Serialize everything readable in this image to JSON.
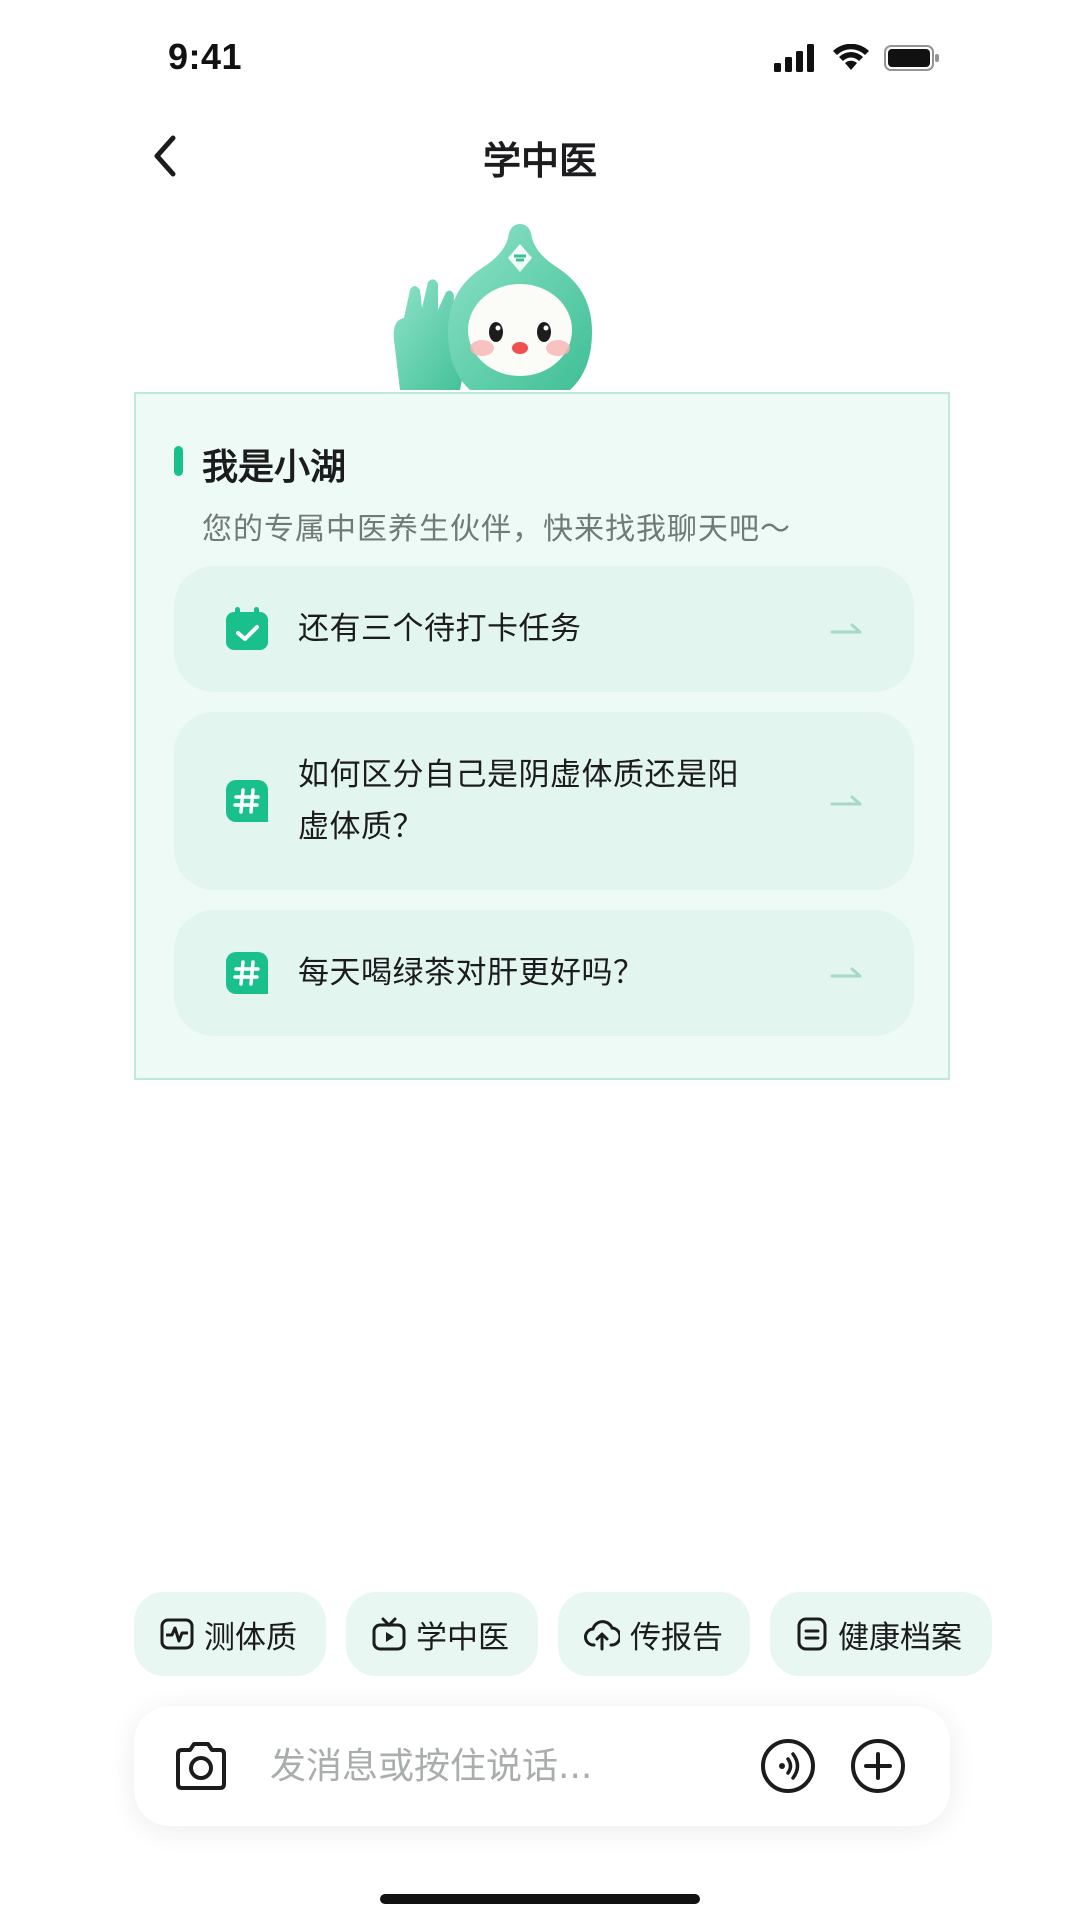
{
  "status_bar": {
    "time": "9:41"
  },
  "header": {
    "title": "学中医"
  },
  "card": {
    "title": "我是小湖",
    "subtitle": "您的专属中医养生伙伴，快来找我聊天吧～",
    "suggestions": [
      {
        "icon": "calendar-check-icon",
        "text": "还有三个待打卡任务"
      },
      {
        "icon": "hashtag-icon",
        "line1": "如何区分自己是阴虚体质还是阳",
        "line2": "虚体质？"
      },
      {
        "icon": "hashtag-icon",
        "text": "每天喝绿茶对肝更好吗？"
      }
    ]
  },
  "quick_actions": [
    {
      "icon": "pulse-chart-icon",
      "label": "测体质"
    },
    {
      "icon": "tv-play-icon",
      "label": "学中医"
    },
    {
      "icon": "cloud-upload-icon",
      "label": "传报告"
    },
    {
      "icon": "document-icon",
      "label": "健康档案"
    }
  ],
  "input_bar": {
    "placeholder": "发消息或按住说话..."
  },
  "colors": {
    "accent": "#19c08c",
    "card_bg": "#eefaf6",
    "chip_bg": "#e8f7f1",
    "suggestion_bg": "#e2f5ee"
  }
}
